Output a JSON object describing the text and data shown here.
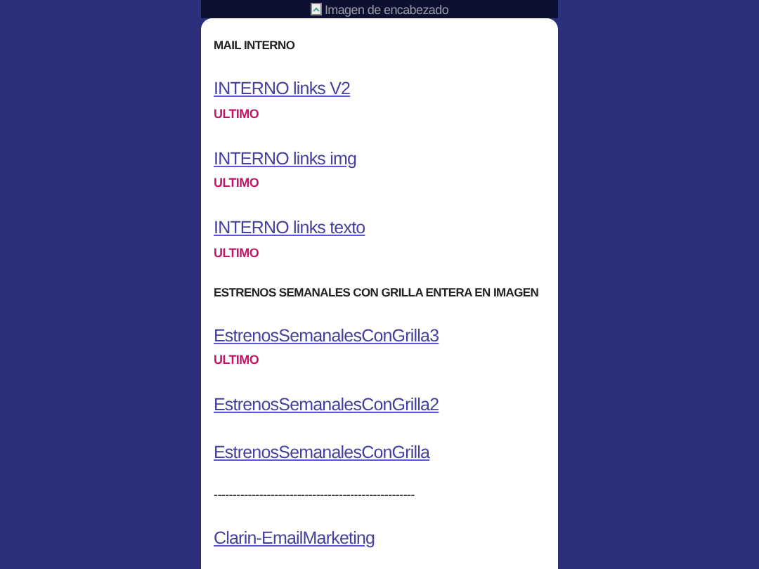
{
  "header": {
    "image_alt": "Imagen de encabezado"
  },
  "items": [
    {
      "kind": "heading",
      "text": "MAIL INTERNO"
    },
    {
      "kind": "link",
      "text": "INTERNO links V2"
    },
    {
      "kind": "tag",
      "text": "ULTIMO"
    },
    {
      "kind": "link",
      "text": "INTERNO links img"
    },
    {
      "kind": "tag",
      "text": "ULTIMO"
    },
    {
      "kind": "link",
      "text": "INTERNO links texto"
    },
    {
      "kind": "tag",
      "text": "ULTIMO"
    },
    {
      "kind": "heading",
      "text": "ESTRENOS SEMANALES CON GRILLA ENTERA EN IMAGEN"
    },
    {
      "kind": "link",
      "text": "EstrenosSemanalesConGrilla3"
    },
    {
      "kind": "tag",
      "text": "ULTIMO"
    },
    {
      "kind": "link",
      "text": "EstrenosSemanalesConGrilla2"
    },
    {
      "kind": "link",
      "text": "EstrenosSemanalesConGrilla"
    },
    {
      "kind": "divider",
      "text": "-----------------------------------------------------"
    },
    {
      "kind": "link",
      "text": "Clarin-EmailMarketing"
    }
  ]
}
